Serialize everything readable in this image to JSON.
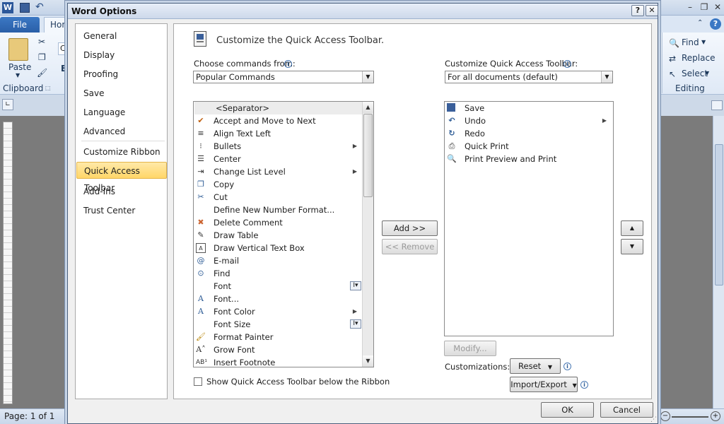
{
  "background": {
    "file_tab": "File",
    "home_tab": "Hom",
    "clipboard": {
      "paste_label": "Paste",
      "group_label": "Clipboard",
      "font_box": "Ca"
    },
    "editing": {
      "find_label": "Find",
      "replace_label": "Replace",
      "select_label": "Select",
      "group_label": "Editing"
    },
    "status": {
      "page_info": "Page: 1 of 1"
    },
    "word_icon": "W"
  },
  "dialog": {
    "title": "Word Options",
    "help_button": "?",
    "close_button": "✕",
    "nav": [
      {
        "label": "General"
      },
      {
        "label": "Display"
      },
      {
        "label": "Proofing"
      },
      {
        "label": "Save"
      },
      {
        "label": "Language"
      },
      {
        "label": "Advanced"
      },
      {
        "label": "Customize Ribbon"
      },
      {
        "label": "Quick Access Toolbar"
      },
      {
        "label": "Add-Ins"
      },
      {
        "label": "Trust Center"
      }
    ],
    "selected_nav": "Quick Access Toolbar",
    "heading": "Customize the Quick Access Toolbar.",
    "choose_label": "Choose commands from:",
    "choose_value": "Popular Commands",
    "customize_label": "Customize Quick Access Toolbar:",
    "customize_value": "For all documents (default)",
    "commands": [
      {
        "label": "<Separator>",
        "icon": ""
      },
      {
        "label": "Accept and Move to Next",
        "icon": "accept-icon"
      },
      {
        "label": "Align Text Left",
        "icon": "align-left-icon"
      },
      {
        "label": "Bullets",
        "icon": "bullets-icon"
      },
      {
        "label": "Center",
        "icon": "center-icon"
      },
      {
        "label": "Change List Level",
        "icon": "list-level-icon"
      },
      {
        "label": "Copy",
        "icon": "copy-icon"
      },
      {
        "label": "Cut",
        "icon": "cut-icon"
      },
      {
        "label": "Define New Number Format...",
        "icon": ""
      },
      {
        "label": "Delete Comment",
        "icon": "delete-comment-icon"
      },
      {
        "label": "Draw Table",
        "icon": "draw-table-icon"
      },
      {
        "label": "Draw Vertical Text Box",
        "icon": "text-box-icon"
      },
      {
        "label": "E-mail",
        "icon": "email-icon"
      },
      {
        "label": "Find",
        "icon": "find-icon"
      },
      {
        "label": "Font",
        "icon": ""
      },
      {
        "label": "Font...",
        "icon": "font-dialog-icon"
      },
      {
        "label": "Font Color",
        "icon": "font-color-icon"
      },
      {
        "label": "Font Size",
        "icon": ""
      },
      {
        "label": "Format Painter",
        "icon": "format-painter-icon"
      },
      {
        "label": "Grow Font",
        "icon": "grow-font-icon"
      },
      {
        "label": "Insert Footnote",
        "icon": "footnote-icon"
      }
    ],
    "toolbar_items": [
      {
        "label": "Save",
        "icon": "save-icon"
      },
      {
        "label": "Undo",
        "icon": "undo-icon"
      },
      {
        "label": "Redo",
        "icon": "redo-icon"
      },
      {
        "label": "Quick Print",
        "icon": "quick-print-icon"
      },
      {
        "label": "Print Preview and Print",
        "icon": "print-preview-icon"
      }
    ],
    "add_button": "Add >>",
    "remove_button": "<< Remove",
    "modify_button": "Modify...",
    "customizations_label": "Customizations:",
    "reset_button": "Reset",
    "import_export_button": "Import/Export",
    "show_below_label": "Show Quick Access Toolbar below the Ribbon",
    "ok_button": "OK",
    "cancel_button": "Cancel"
  }
}
